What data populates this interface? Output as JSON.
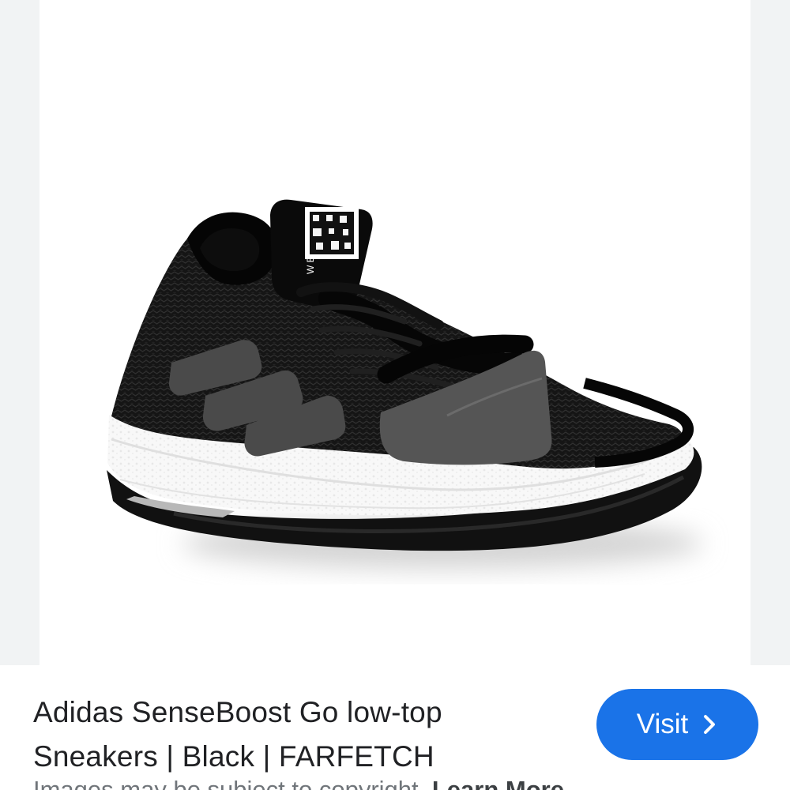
{
  "result": {
    "title_line1": "Adidas SenseBoost Go low-top",
    "title_line2": "Sneakers | Black | FARFETCH",
    "visit_label": "Visit",
    "copyright_text": "Images may be subject to copyright.",
    "learn_more_label": "Learn More"
  },
  "image": {
    "tab_text": "W E",
    "subject": "black knit running sneaker with white sole and grey stripes"
  },
  "colors": {
    "accent": "#1a73e8",
    "title_text": "#202124",
    "secondary_text": "#70757a",
    "viewer_side_background": "#f1f3f4"
  },
  "icons": {
    "visit_chevron": "chevron-right-icon"
  }
}
